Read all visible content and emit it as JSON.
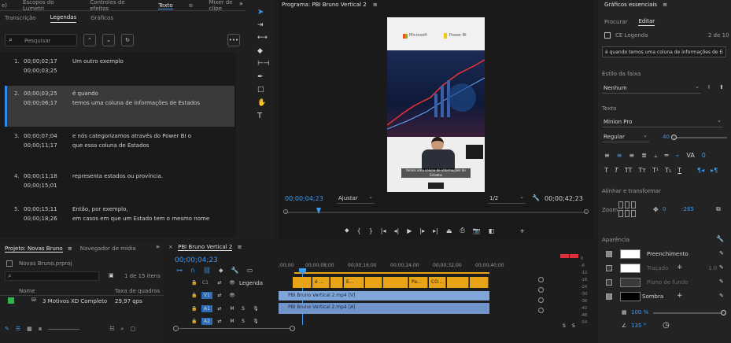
{
  "top_tabs_left": [
    "e)",
    "Escopos do Lumetri",
    "Controles de efeitos",
    "Texto",
    "Mixer de clipe"
  ],
  "text_panel": {
    "tabs": [
      "Transcrição",
      "Legendas",
      "Gráficos"
    ],
    "search_placeholder": "Pesquisar",
    "captions": [
      {
        "num": "1.",
        "in": "00;00;02;17",
        "out": "00;00;03;25",
        "line1": "Um outro exemplo",
        "line2": ""
      },
      {
        "num": "2.",
        "in": "00;00;03;25",
        "out": "00;00;06;17",
        "line1": "é quando",
        "line2": "temos uma coluna de informações de Estados"
      },
      {
        "num": "3.",
        "in": "00;00;07;04",
        "out": "00;00;11;17",
        "line1": "e nós categorizamos através do Power BI o",
        "line2": "que essa coluna de Estados"
      },
      {
        "num": "4.",
        "in": "00;00;11;18",
        "out": "00;00;15;01",
        "line1": "representa estados ou província.",
        "line2": ""
      },
      {
        "num": "5.",
        "in": "00;00;15;11",
        "out": "00;00;18;26",
        "line1": "Então, por exemplo,",
        "line2": "em casos em que um Estado tem o mesmo nome"
      }
    ]
  },
  "program": {
    "title": "Programa: PBI Bruno Vertical 2",
    "timecode_current": "00;00;04;23",
    "fit_label": "Ajustar",
    "resolution": "1/2",
    "timecode_duration": "00;00;42;23",
    "video_logo_left": "Microsoft",
    "video_logo_right": "Power BI",
    "video_caption": "temos uma coluna de informações de Estados"
  },
  "essential_graphics": {
    "title": "Gráficos essenciais",
    "tabs": [
      "Procurar",
      "Editar"
    ],
    "layer_name": "CE Legenda",
    "layer_count": "2 de 10",
    "text_value": "é quando temos uma coluna de informações de Es...",
    "track_style_label": "Estilo da faixa",
    "track_style_value": "Nenhum",
    "text_section": "Texto",
    "font_family": "Minion Pro",
    "font_style": "Regular",
    "font_size": "40",
    "tracking_value": "0",
    "align_transform_section": "Alinhar e transformar",
    "zoom_label": "Zoom",
    "position_x": "0",
    "position_y": "-265",
    "appearance_section": "Aparência",
    "fill_label": "Preenchimento",
    "stroke_label": "Traçado",
    "stroke_value": "1.0",
    "background_label": "Plano de fundo",
    "shadow_label": "Sombra",
    "bg_opacity": "100 %",
    "angle_value": "135 °"
  },
  "project": {
    "tabs": [
      "Projeto: Novas Bruno",
      "Navegador de mídia"
    ],
    "file_name": "Novas Bruno.prproj",
    "count": "1 de 15 itens",
    "col_name": "Nome",
    "col_rate": "Taxa de quadros",
    "item_name": "3 Motivos XD Completo",
    "item_rate": "29,97 qps"
  },
  "timeline": {
    "title": "PBI Bruno Vertical 2",
    "timecode": "00;00;04;23",
    "ruler": [
      ";00;00",
      "00;00;08;00",
      "00;00;16;00",
      "00;00;24;00",
      "00;00;32;00",
      "00;00;40;00"
    ],
    "track_caption": "Legenda",
    "track_c1": "C1",
    "track_v1": "V1",
    "track_a1": "A1",
    "track_a2": "A2",
    "clips": [
      "",
      "é ...",
      "",
      "E...",
      "",
      "",
      "Pa...",
      "CO...",
      "",
      ""
    ],
    "video_clip": "PBI Bruno Vertical 2.mp4 [V]",
    "audio_clip": "PBI Bruno Vertical 2.mp4 [A]"
  },
  "meter": {
    "marks": [
      "0",
      "-6",
      "-12",
      "-18",
      "-24",
      "-30",
      "-36",
      "-42",
      "-48",
      "-54"
    ],
    "solo": [
      "S",
      "S"
    ]
  }
}
